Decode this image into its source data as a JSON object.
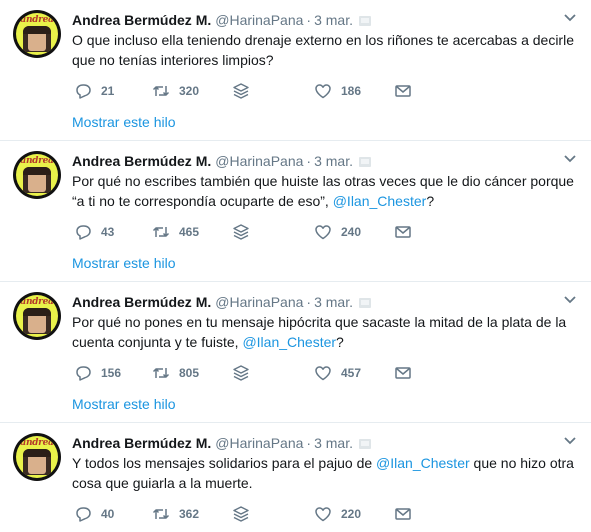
{
  "tweets": [
    {
      "name": "Andrea Bermúdez M.",
      "handle": "@HarinaPana",
      "separator": "·",
      "date": "3 mar.",
      "text_lines": [
        "O que incluso ella teniendo drenaje externo en los riñones te acercabas a decirle",
        "que no tenías interiores limpios?"
      ],
      "replies": "21",
      "retweets": "320",
      "likes": "186",
      "thread_link": "Mostrar este hilo"
    },
    {
      "name": "Andrea Bermúdez M.",
      "handle": "@HarinaPana",
      "separator": "·",
      "date": "3 mar.",
      "text_lines": [
        "Por qué no escribes también que huiste las otras veces que le dio cáncer porque",
        "“a ti no te correspondía ocuparte de eso”, "
      ],
      "mention": "@Ilan_Chester",
      "text_after_mention": "?",
      "replies": "43",
      "retweets": "465",
      "likes": "240",
      "thread_link": "Mostrar este hilo"
    },
    {
      "name": "Andrea Bermúdez M.",
      "handle": "@HarinaPana",
      "separator": "·",
      "date": "3 mar.",
      "text_lines": [
        "Por qué no pones en tu mensaje hipócrita que sacaste la mitad de la plata de la",
        "cuenta conjunta y te fuiste, "
      ],
      "mention": "@Ilan_Chester",
      "text_after_mention": "?",
      "replies": "156",
      "retweets": "805",
      "likes": "457",
      "thread_link": "Mostrar este hilo"
    },
    {
      "name": "Andrea Bermúdez M.",
      "handle": "@HarinaPana",
      "separator": "·",
      "date": "3 mar.",
      "text_before_mention": "Y todos los mensajes solidarios para el pajuo de ",
      "mention": "@Ilan_Chester",
      "text_after_mention": " que no hizo otra",
      "text_line2": "cosa que guiarla a la muerte.",
      "replies": "40",
      "retweets": "362",
      "likes": "220"
    }
  ],
  "avatar_text": "andrea",
  "icons": {
    "reply": "reply-icon",
    "retweet": "retweet-icon",
    "stack": "layers-icon",
    "like": "heart-icon",
    "dm": "envelope-icon",
    "caret": "chevron-down-icon",
    "device": "device-icon"
  },
  "colors": {
    "link": "#1b95e0",
    "muted": "#657786",
    "divider": "#e6ecf0"
  }
}
